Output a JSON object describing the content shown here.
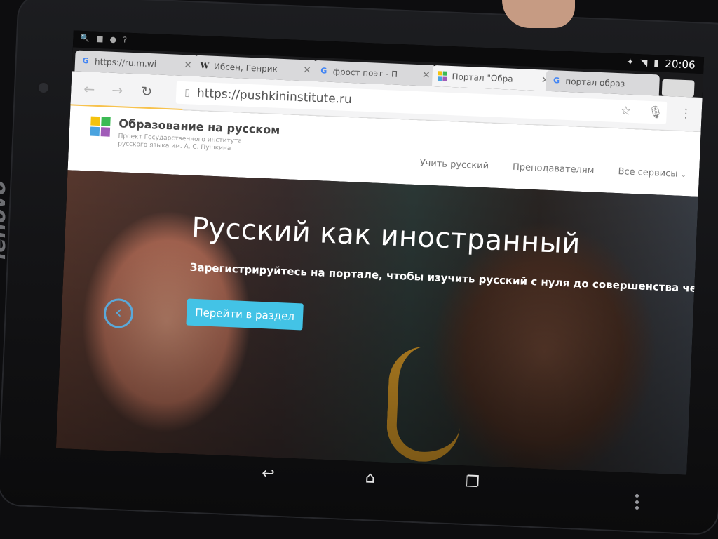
{
  "device": {
    "brand": "lenovo"
  },
  "statusbar": {
    "time": "20:06",
    "left_icons": [
      "search-icon",
      "app-icon",
      "app-icon",
      "question-icon"
    ],
    "right_icons": [
      "star-icon",
      "wifi-icon",
      "signal-icon"
    ]
  },
  "tabs": [
    {
      "favicon": "google-favicon",
      "title": "https://ru.m.wi",
      "active": false
    },
    {
      "favicon": "wikipedia-favicon",
      "title": "Ибсен, Генрик",
      "active": false
    },
    {
      "favicon": "google-favicon",
      "title": "фрост поэт - П",
      "active": false
    },
    {
      "favicon": "portal-favicon",
      "title": "Портал \"Обра",
      "active": true
    },
    {
      "favicon": "google-favicon",
      "title": "портал образ",
      "active": false
    }
  ],
  "toolbar": {
    "url": "https://pushkininstitute.ru"
  },
  "site": {
    "title": "Образование на русском",
    "subtitle": "Проект Государственного института русского языка им. А. С. Пушкина",
    "nav": [
      "Учить русский",
      "Преподавателям",
      "Все сервисы"
    ]
  },
  "hero": {
    "title": "Русский как иностранный",
    "text": "Зарегистрируйтесь на портале, чтобы изучить русский с нуля до совершенства через интернет.",
    "button": "Перейти в раздел"
  },
  "colors": {
    "accent": "#43c3e6",
    "progress": "#f7c24d",
    "logo": [
      "#f4c20d",
      "#3cba54",
      "#4aa3df",
      "#a05cb8"
    ]
  }
}
